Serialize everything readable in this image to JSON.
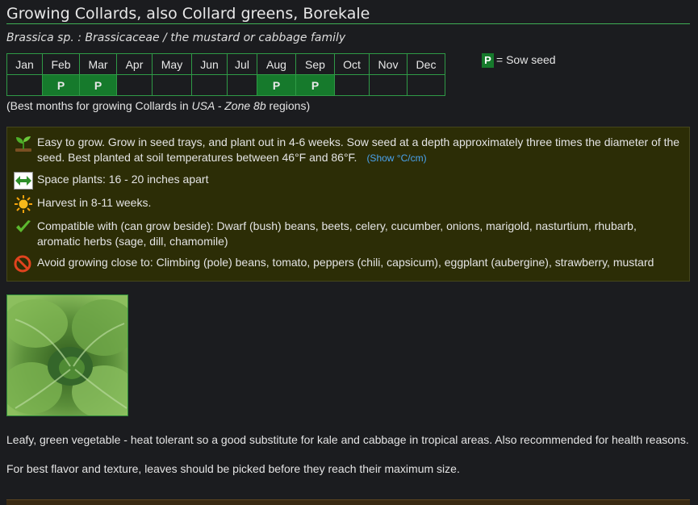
{
  "page": {
    "title": "Growing Collards, also Collard greens, Borekale",
    "subtitle": "Brassica sp. : Brassicaceae / the mustard or cabbage family"
  },
  "calendar": {
    "months": [
      "Jan",
      "Feb",
      "Mar",
      "Apr",
      "May",
      "Jun",
      "Jul",
      "Aug",
      "Sep",
      "Oct",
      "Nov",
      "Dec"
    ],
    "plant": [
      "",
      "P",
      "P",
      "",
      "",
      "",
      "",
      "P",
      "P",
      "",
      "",
      ""
    ]
  },
  "legend": {
    "symbol": "P",
    "text": "= Sow seed"
  },
  "note": {
    "prefix": "(Best months for growing Collards in ",
    "region": "USA - Zone 8b",
    "suffix": " regions)"
  },
  "tips": {
    "grow": "Easy to grow. Grow in seed trays, and plant out in 4-6 weeks. Sow seed at a depth approximately three times the diameter of the seed. Best planted at soil temperatures between 46°F and 86°F.",
    "show_link": "(Show °C/cm)",
    "space": "Space plants: 16 - 20 inches apart",
    "harvest": "Harvest in 8-11 weeks.",
    "compatible": "Compatible with (can grow beside): Dwarf (bush) beans, beets, celery, cucumber, onions, marigold, nasturtium, rhubarb, aromatic herbs (sage, dill, chamomile)",
    "avoid": "Avoid growing close to: Climbing (pole) beans, tomato, peppers (chili, capsicum), eggplant (aubergine), strawberry, mustard"
  },
  "icons": {
    "grow": "seedling-icon",
    "space": "spacing-arrows-icon",
    "harvest": "sun-icon",
    "compatible": "checkmark-icon",
    "avoid": "no-entry-icon"
  },
  "description": {
    "p1": "Leafy, green vegetable - heat tolerant so a good substitute for kale and cabbage in tropical areas. Also recommended for health reasons.",
    "p2": "For best flavor and texture, leaves should be picked before they reach their maximum size."
  },
  "colors": {
    "background": "#1b1c1f",
    "accent_green": "#167a2c",
    "border_green": "#2f9a46",
    "tips_bg": "#2c2d06",
    "link": "#4aa3ee"
  }
}
